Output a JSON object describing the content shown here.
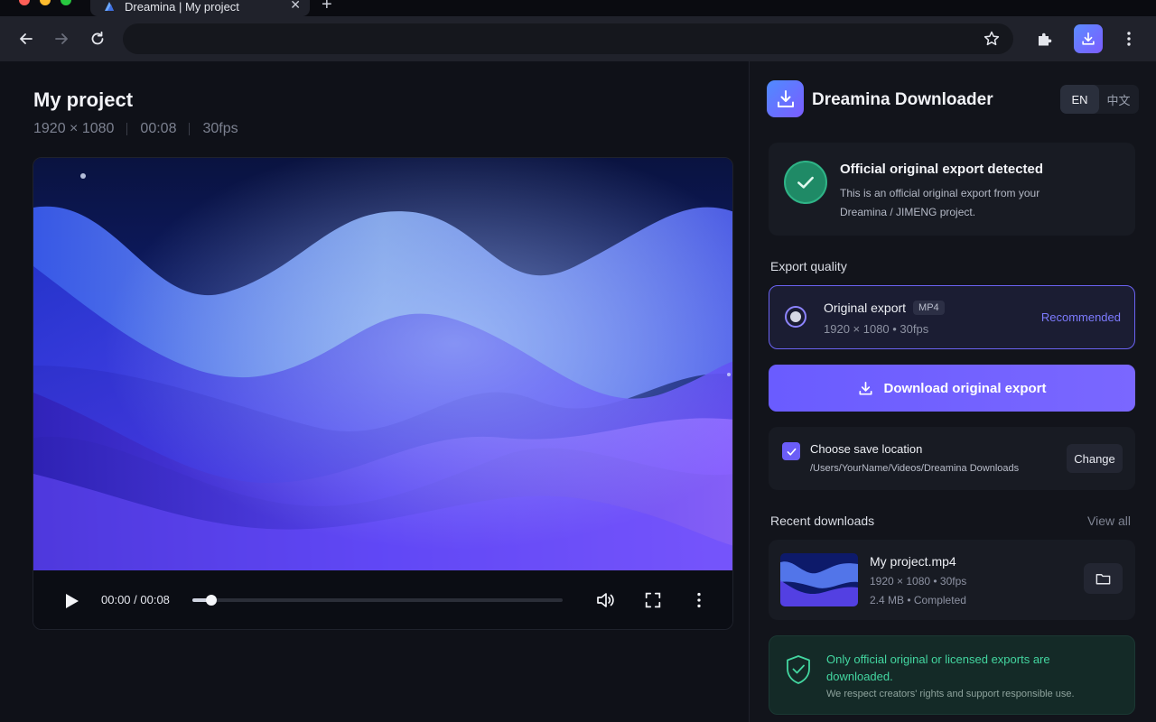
{
  "browser": {
    "tab_title": "Dreamina | My project",
    "tab_close": "✕",
    "new_tab": "+",
    "address": ""
  },
  "project": {
    "title": "My project",
    "resolution": "1920 × 1080",
    "duration": "00:08",
    "fps": "30fps"
  },
  "player": {
    "time": "00:00 / 00:08",
    "progress": 0.05
  },
  "extension": {
    "name": "Dreamina Downloader",
    "languages": [
      "EN",
      "中文"
    ],
    "active_language": "EN",
    "detection": {
      "title": "Official original export detected",
      "description": "This is an official original export from your Dreamina / JIMENG project."
    },
    "export_quality": {
      "label": "Export quality",
      "option_title": "Original export",
      "format_badge": "MP4",
      "option_meta": "1920 × 1080  •  30fps",
      "tag": "Recommended"
    },
    "download_button": "Download original export",
    "save_location": {
      "title": "Choose save location",
      "path": "/Users/YourName/Videos/Dreamina Downloads",
      "change_button": "Change",
      "checked": true
    },
    "recent": {
      "label": "Recent downloads",
      "view_all": "View all",
      "items": [
        {
          "name": "My project.mp4",
          "meta1": "1920 × 1080  •  30fps",
          "meta2": "2.4 MB  •  Completed"
        }
      ]
    },
    "notice": {
      "title": "Only official original or licensed exports are downloaded.",
      "subtitle": "We respect creators' rights and support responsible use."
    }
  },
  "colors": {
    "accent": "#6b5df7",
    "success": "#43d6a0",
    "panel_bg": "#12141b",
    "page_bg": "#0f1118"
  }
}
